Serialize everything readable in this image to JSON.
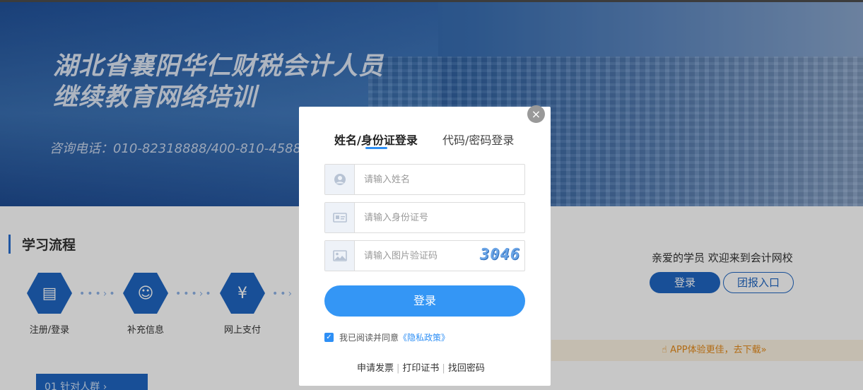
{
  "banner": {
    "title_line1": "湖北省襄阳华仁财税会计人员",
    "title_line2": "继续教育网络培训",
    "phone": "咨询电话：010-82318888/400-810-4588"
  },
  "process": {
    "title": "学习流程",
    "steps": [
      {
        "label": "注册/登录",
        "icon": "clipboard-icon"
      },
      {
        "label": "补充信息",
        "icon": "user-check-icon"
      },
      {
        "label": "网上支付",
        "icon": "money-bag-icon"
      }
    ],
    "target_button": "01 针对人群 ›"
  },
  "side": {
    "welcome": "亲爱的学员 欢迎来到会计网校",
    "login_label": "登录",
    "group_label": "团报入口",
    "app_bar": "APP体验更佳，去下载»"
  },
  "modal": {
    "close": "×",
    "tab_active": "姓名/身份证登录",
    "tab_inactive": "代码/密码登录",
    "name_placeholder": "请输入姓名",
    "id_placeholder": "请输入身份证号",
    "captcha_placeholder": "请输入图片验证码",
    "captcha_code": "3046",
    "login_button": "登录",
    "agree_text": "我已阅读并同意",
    "policy_link": "《隐私政策》",
    "links": [
      "申请发票",
      "打印证书",
      "找回密码"
    ]
  },
  "colors": {
    "accent": "#3496f5",
    "brand_dark": "#1f66c2"
  }
}
